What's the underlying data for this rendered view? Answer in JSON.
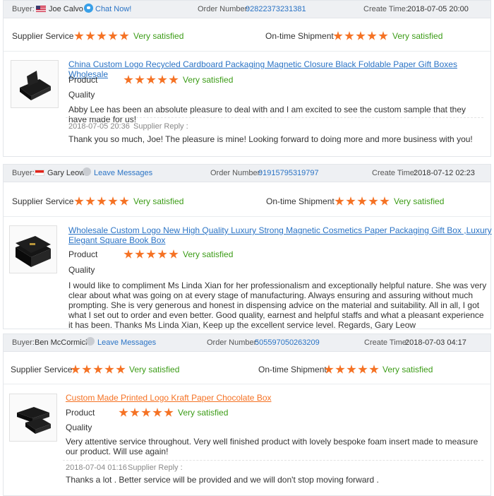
{
  "labels": {
    "buyer": "Buyer:",
    "order_number": "Order Number:",
    "create_time": "Create Time:",
    "supplier_service": "Supplier Service",
    "ontime_shipment": "On-time Shipment",
    "product": "Product",
    "quality": "Quality",
    "very_satisfied": "Very satisfied",
    "supplier_reply": "Supplier Reply :"
  },
  "colors": {
    "star": "#f57224",
    "link": "#2a73c5",
    "satisfied": "#3c9c17",
    "header_bg": "#eef0f3"
  },
  "reviews": [
    {
      "buyer_name": "Joe Calvo",
      "flag": "us-flag",
      "contact_label": "Chat Now!",
      "contact_icon": "chat-icon",
      "order_number": "92822373231381",
      "create_time": "2018-07-05 20:00",
      "supplier_service_stars": 5,
      "ontime_shipment_stars": 5,
      "product_title": "China Custom Logo Recycled Cardboard Packaging Magnetic Closure Black Foldable Paper Gift Boxes Wholesale",
      "product_stars": 5,
      "comment": "Abby Lee has been an absolute pleasure to deal with and I am excited to see the custom sample that they have made for us!",
      "reply_time": "2018-07-05 20:36",
      "reply_text": "Thank you so much, Joe! The pleasure is mine! Looking forward to doing more and more business with you!"
    },
    {
      "buyer_name": "Gary Leow",
      "flag": "sg-flag",
      "contact_label": "Leave Messages",
      "contact_icon": "message-icon",
      "order_number": "91915795319797",
      "create_time": "2018-07-12 02:23",
      "supplier_service_stars": 5,
      "ontime_shipment_stars": 5,
      "product_title": "Wholesale Custom Logo New High Quality Luxury Strong Magnetic Cosmetics Paper Packaging Gift Box ,Luxury Elegant Square Book Box",
      "product_stars": 5,
      "comment": "I would like to compliment Ms Linda Xian for her professionalism and exceptionally helpful nature. She was very clear about what was going on at every stage of manufacturing. Always ensuring and assuring without much prompting. She is very generous and honest in dispensing advice on the material and suitability. All in all, I got what I set out to order and even better. Good quality, earnest and helpful staffs and what a pleasant experience it has been. Thanks Ms Linda Xian, Keep up the excellent service level. Regards, Gary Leow"
    },
    {
      "buyer_name": "Ben McCormick",
      "flag": "",
      "contact_label": "Leave Messages",
      "contact_icon": "message-icon",
      "order_number": "505597050263209",
      "create_time": "2018-07-03 04:17",
      "supplier_service_stars": 5,
      "ontime_shipment_stars": 5,
      "product_title": "Custom Made Printed Logo Kraft Paper Chocolate Box",
      "product_stars": 5,
      "comment": "Very attentive service throughout. Very well finished product with lovely bespoke foam insert made to measure our product. Will use again!",
      "reply_time": "2018-07-04 01:16",
      "reply_text": "Thanks a lot . Better service will be provided and we will don't stop moving forward ."
    }
  ]
}
